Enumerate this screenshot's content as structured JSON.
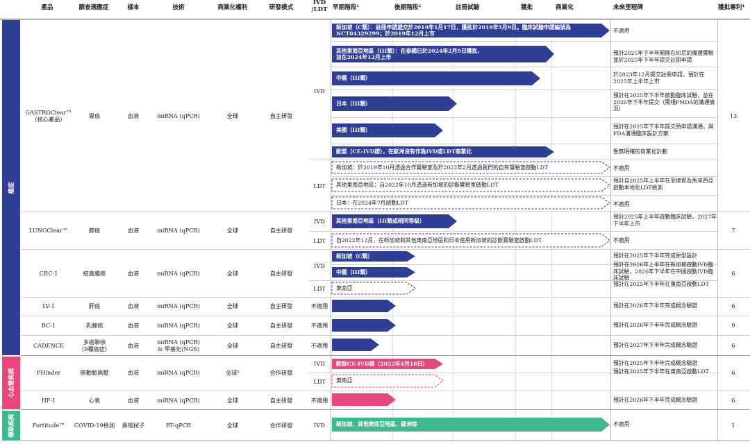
{
  "colors": {
    "oncology": "#2f3f95",
    "cardio": "#e8467c",
    "infectious": "#3fb88d"
  },
  "headers": {
    "product": "產品",
    "indication": "篩查適應症",
    "sample": "樣本",
    "technology": "技術",
    "rights": "商業化權利",
    "model": "研發模式",
    "ivd_ldt": "IVD\n/LDT",
    "early": "早期階段¹",
    "late": "後期階段²",
    "registration": "註冊試驗",
    "approval": "獲批",
    "commercial": "商業化",
    "milestone": "未來里程碑",
    "patents": "獲批專利⁴"
  },
  "categories": [
    {
      "label": "癌症",
      "color": "#2f3f95"
    },
    {
      "label": "心血管疾病",
      "color": "#e8467c"
    },
    {
      "label": "傳染疾病",
      "color": "#3fb88d"
    }
  ],
  "products": [
    {
      "name": "GASTROClear™\n（核心產品）",
      "indication": "胃癌",
      "sample": "血液",
      "technology": "miRNA (qPCR)",
      "rights": "全球",
      "model": "自主研發",
      "patents": "13"
    },
    {
      "name": "LUNGClear™",
      "indication": "肺癌",
      "sample": "血液",
      "technology": "miRNA (qPCR)",
      "rights": "全球",
      "model": "自主研發",
      "patents": "7"
    },
    {
      "name": "CRC-1",
      "indication": "結直腸癌",
      "sample": "血液",
      "technology": "miRNA (qPCR)",
      "rights": "全球",
      "model": "自主研發",
      "patents": "6"
    },
    {
      "name": "LV-1",
      "indication": "肝癌",
      "sample": "血液",
      "technology": "miRNA (qPCR)",
      "rights": "全球",
      "model": "自主研發",
      "patents": "6"
    },
    {
      "name": "BC-1",
      "indication": "乳腺癌",
      "sample": "血液",
      "technology": "miRNA (qPCR)",
      "rights": "全球",
      "model": "自主研發",
      "patents": "9"
    },
    {
      "name": "CADENCE",
      "indication": "多癌聯檢\n（9種癌症）",
      "sample": "血液",
      "technology": "miRNA (qPCR)\n& 甲基化(NGS)",
      "rights": "全球",
      "model": "自主研發",
      "patents": "6"
    },
    {
      "name": "PHinder",
      "indication": "肺動脈高壓",
      "sample": "血液",
      "technology": "miRNA (qPCR)",
      "rights": "全球³",
      "model": "合作研發",
      "patents": "6"
    },
    {
      "name": "HF-1",
      "indication": "心衰",
      "sample": "血液",
      "technology": "miRNA (qPCR)",
      "rights": "全球",
      "model": "自主研發",
      "patents": "6"
    },
    {
      "name": "Fortitude™",
      "indication": "COVID-19檢測",
      "sample": "鼻咽拭子",
      "technology": "RT-qPCR",
      "rights": "全球",
      "model": "合作研發",
      "patents": "1"
    }
  ],
  "type_labels": [
    "IVD",
    "LDT",
    "IVD",
    "LDT",
    "IVD",
    "LDT",
    "不適用",
    "不適用",
    "不適用",
    "IVD",
    "LDT",
    "不適用",
    "IVD"
  ],
  "pipeline": [
    {
      "label": "新加坡（C類）：註冊申請遞交於2019年1月17日，獲批於2019年5月9日。臨床試驗申請編號為\nNCT04329299；於2019年12月上市",
      "style": "solid",
      "color": "oncology",
      "progress": 1.0,
      "milestone": "不適用"
    },
    {
      "label": "其他東南亞地區（III類）：在泰國已於2024年2月9日獲批，\n並在2024年12月上市",
      "style": "solid",
      "color": "oncology",
      "progress": 0.8,
      "milestone": "預計2025年下半年開展在印尼的備援實驗並於2025年下半年提交註冊申請"
    },
    {
      "label": "中國（III類）",
      "style": "solid",
      "color": "oncology",
      "progress": 0.75,
      "milestone": "於2023年12月提交註冊申請，預計在2025年上半年上市"
    },
    {
      "label": "日本（III類）",
      "style": "solid",
      "color": "oncology",
      "progress": 0.45,
      "milestone": "預計在2025年下半年啟動臨床試驗，並在2026年下半年提交（需視PMDA的溝通情況）"
    },
    {
      "label": "美國（III類）",
      "style": "solid",
      "color": "oncology",
      "progress": 0.4,
      "milestone": "預計在2025年下半年提交預申請溝通，與FDA溝通臨床設計方案"
    },
    {
      "label": "歐盟（CE-IVD證），在歐洲沒有作為IVD或LDT商業化",
      "style": "solid",
      "color": "oncology",
      "progress": 0.8,
      "milestone": "暫無明確的商業化計劃"
    },
    {
      "label": "新加坡：於2019年10月透過合作實驗室及於2022年2月透過我們的自有實驗室啟動LDT",
      "style": "dashed",
      "color": "oncology",
      "progress": 1.0,
      "milestone": "不適用"
    },
    {
      "label": "其他東南亞地區：自2022年10月透過新加坡的診斷實驗室啟動LDT",
      "style": "dashed",
      "color": "oncology",
      "progress": 1.0,
      "milestone": "預計自2025年上半年在菲律賓及馬來西亞啟動本地化LDT檢測"
    },
    {
      "label": "日本：在2024年7月啟動LDT",
      "style": "dashed",
      "color": "oncology",
      "progress": 1.0,
      "milestone": "不適用"
    },
    {
      "label": "其他東南亞地區（III類或相同等級）",
      "style": "solid",
      "color": "oncology",
      "progress": 0.45,
      "milestone": "預計2025年上半年啟動臨床試驗，2027年下半年上市"
    },
    {
      "label": "自2022年12月，在新加坡和其他東南亞地區和日本使用新加坡的診斷實驗室啟動LDT",
      "style": "dashed",
      "color": "oncology",
      "progress": 1.0,
      "milestone": "不適用"
    },
    {
      "label": "新加坡（C類）",
      "style": "solid",
      "color": "oncology",
      "progress": 0.3,
      "milestone": "預計在2025年下半年完成原型設計"
    },
    {
      "label": "中國（III類）",
      "style": "solid",
      "color": "oncology",
      "progress": 0.3,
      "milestone": "預計在2026年上半年在新加坡啟動IVD臨床試驗，2026年下半年在中國啟動IVD臨床試驗"
    },
    {
      "label": "東南亞",
      "style": "dashed",
      "color": "oncology",
      "progress": 0.3,
      "milestone": "預計在2025年下半年在東南亞啟動LDT"
    },
    {
      "label": "",
      "style": "solid",
      "color": "oncology",
      "progress": 0.23,
      "milestone": "預計在2026年下半年完成概念驗證"
    },
    {
      "label": "",
      "style": "solid",
      "color": "oncology",
      "progress": 0.23,
      "milestone": "預計在2026年下半年完成概念驗證"
    },
    {
      "label": "",
      "style": "solid",
      "color": "oncology",
      "progress": 0.17,
      "milestone": "預計在2027年下半年完成概念驗證"
    },
    {
      "label": "歐盟CE-IVD證（2022年4月18日）",
      "style": "solid",
      "color": "cardio",
      "progress": 0.4,
      "milestone": "預計在2025年下半年完成概念驗證"
    },
    {
      "label": "東南亞",
      "style": "dashed",
      "color": "cardio",
      "progress": 0.4,
      "milestone": "預計在2025年下半年在東南亞啟動LDT"
    },
    {
      "label": "",
      "style": "solid",
      "color": "cardio",
      "progress": 0.23,
      "milestone": "預計在2026年下半年完成概念驗證"
    },
    {
      "label": "新加坡、其他東南亞地區、歐洲等",
      "style": "solid",
      "color": "infectious",
      "progress": 1.0,
      "milestone": "不適用"
    }
  ]
}
